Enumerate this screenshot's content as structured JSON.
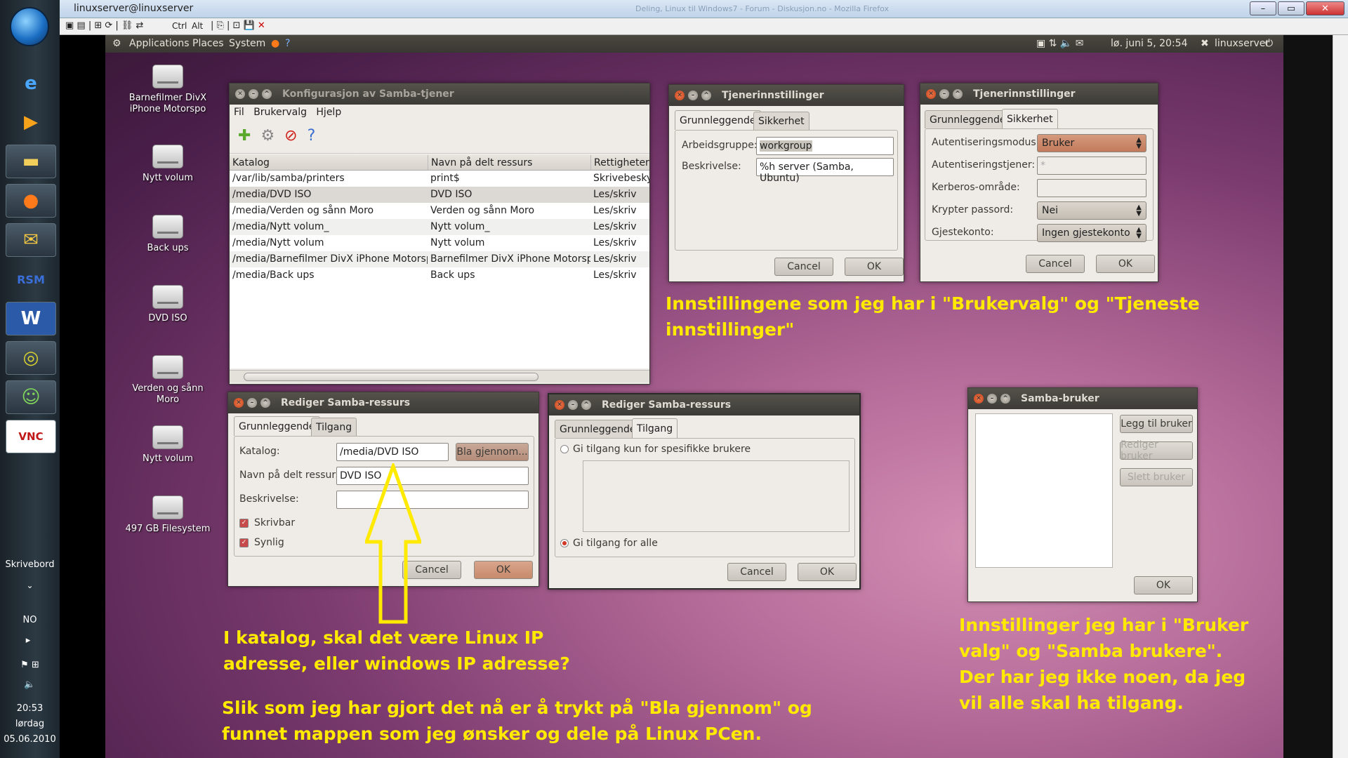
{
  "vnc": {
    "title": "linuxserver@linuxserver",
    "browser_tab": "Deling, Linux til Windows7 - Forum - Diskusjon.no - Mozilla Firefox",
    "toolbar": [
      "Ctrl",
      "Alt"
    ]
  },
  "win_taskbar": {
    "desktop_label": "Skrivebord",
    "lang": "NO",
    "time": "20:53",
    "day": "lørdag",
    "date": "05.06.2010"
  },
  "gnome_panel": {
    "applications": "Applications",
    "places": "Places",
    "system": "System",
    "datetime": "lø. juni  5, 20:54",
    "user": "linuxserver"
  },
  "desktop_icons": [
    "Barnefilmer DivX iPhone Motorspo",
    "Nytt volum",
    "Back ups",
    "DVD ISO",
    "Verden og sånn Moro",
    "Nytt volum",
    "497 GB Filesystem"
  ],
  "samba_main": {
    "title": "Konfigurasjon av Samba-tjener",
    "menu": [
      "Fil",
      "Brukervalg",
      "Hjelp"
    ],
    "columns": [
      "Katalog",
      "Navn på delt ressurs",
      "Rettigheter"
    ],
    "rows": [
      [
        "/var/lib/samba/printers",
        "print$",
        "Skrivebesky"
      ],
      [
        "/media/DVD ISO",
        "DVD ISO",
        "Les/skriv"
      ],
      [
        "/media/Verden og sånn Moro",
        "Verden og sånn Moro",
        "Les/skriv"
      ],
      [
        "/media/Nytt volum_",
        "Nytt volum_",
        "Les/skriv"
      ],
      [
        "/media/Nytt volum",
        "Nytt volum",
        "Les/skriv"
      ],
      [
        "/media/Barnefilmer DivX iPhone Motorspo",
        "Barnefilmer DivX iPhone Motorspo",
        "Les/skriv"
      ],
      [
        "/media/Back ups",
        "Back ups",
        "Les/skriv"
      ]
    ]
  },
  "server_basic": {
    "title": "Tjenerinnstillinger",
    "tab_basic": "Grunnleggende",
    "tab_security": "Sikkerhet",
    "workgroup_label": "Arbeidsgruppe:",
    "workgroup_value": "workgroup",
    "description_label": "Beskrivelse:",
    "description_value": "%h server (Samba, Ubuntu)",
    "cancel": "Cancel",
    "ok": "OK"
  },
  "server_security": {
    "title": "Tjenerinnstillinger",
    "tab_basic": "Grunnleggende",
    "tab_security": "Sikkerhet",
    "auth_mode_label": "Autentiseringsmodus:",
    "auth_mode_value": "Bruker",
    "auth_server_label": "Autentiseringstjener:",
    "auth_server_value": "*",
    "kerberos_label": "Kerberos-område:",
    "encrypt_label": "Krypter passord:",
    "encrypt_value": "Nei",
    "guest_label": "Gjestekonto:",
    "guest_value": "Ingen gjestekonto",
    "cancel": "Cancel",
    "ok": "OK"
  },
  "edit_basic": {
    "title": "Rediger Samba-ressurs",
    "tab_basic": "Grunnleggende",
    "tab_access": "Tilgang",
    "dir_label": "Katalog:",
    "dir_value": "/media/DVD ISO",
    "browse": "Bla gjennom...",
    "share_label": "Navn på delt ressurs",
    "share_value": "DVD ISO",
    "desc_label": "Beskrivelse:",
    "desc_value": "",
    "writable": "Skrivbar",
    "visible": "Synlig",
    "cancel": "Cancel",
    "ok": "OK"
  },
  "edit_access": {
    "title": "Rediger Samba-ressurs",
    "tab_basic": "Grunnleggende",
    "tab_access": "Tilgang",
    "opt_specific": "Gi tilgang kun for spesifikke brukere",
    "opt_all": "Gi tilgang for alle",
    "cancel": "Cancel",
    "ok": "OK"
  },
  "samba_users": {
    "title": "Samba-bruker",
    "add": "Legg til bruker",
    "edit": "Rediger bruker",
    "delete": "Slett bruker",
    "ok": "OK"
  },
  "annotations": {
    "top": [
      "Innstillingene som jeg har i \"Brukervalg\" og \"Tjeneste",
      "innstillinger\""
    ],
    "question": [
      "I katalog, skal det være Linux IP",
      "adresse, eller windows IP adresse?"
    ],
    "bottom": [
      "Slik som jeg har gjort det nå er å trykt på \"Bla gjennom\" og",
      "funnet mappen som jeg ønsker og dele på Linux PCen."
    ],
    "right": [
      "Innstillinger jeg har i \"Bruker",
      "valg\" og \"Samba brukere\".",
      "Der har jeg ikke noen, da jeg",
      "vil alle skal ha tilgang."
    ]
  },
  "colors": {
    "annotation": "#ffea00",
    "title_bar": "#3c3b37",
    "close_button": "#e0501f"
  }
}
